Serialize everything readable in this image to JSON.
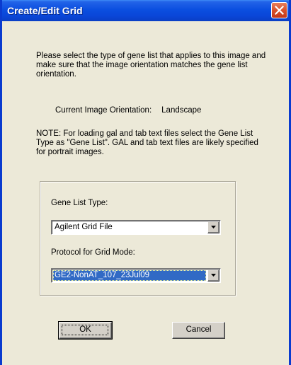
{
  "window": {
    "title": "Create/Edit Grid"
  },
  "instructions": "Please select the type of gene list that applies to this image and make sure that the image orientation matches the gene list orientation.",
  "orientation": {
    "label": "Current Image Orientation:",
    "value": "Landscape"
  },
  "note": "NOTE: For loading gal and tab text files select the Gene List Type as \"Gene List\". GAL and tab text files are likely specified for portrait images.",
  "gene_list_type": {
    "label": "Gene List Type:",
    "value": "Agilent Grid File"
  },
  "protocol": {
    "label": "Protocol for Grid Mode:",
    "value": "GE2-NonAT_107_23Jul09"
  },
  "buttons": {
    "ok": "OK",
    "cancel": "Cancel"
  },
  "colors": {
    "titlebar": "#0a46d8",
    "dialog_bg": "#ece9d8",
    "selection": "#316ac5",
    "close_button": "#d9512b"
  },
  "icons": {
    "close": "close-icon",
    "dropdown": "chevron-down-icon"
  }
}
